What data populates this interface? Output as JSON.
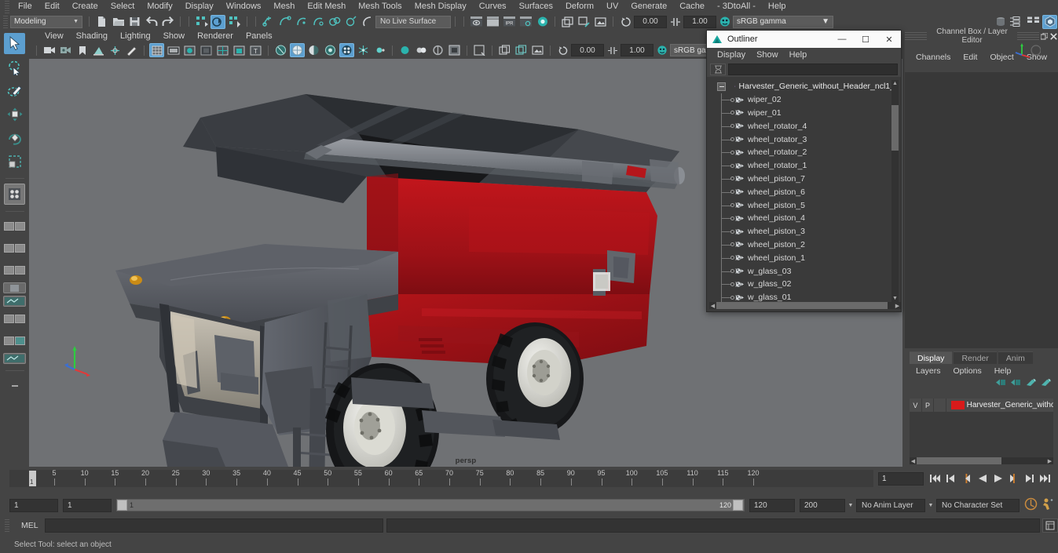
{
  "menubar": {
    "items": [
      "File",
      "Edit",
      "Create",
      "Select",
      "Modify",
      "Display",
      "Windows",
      "Mesh",
      "Edit Mesh",
      "Mesh Tools",
      "Mesh Display",
      "Curves",
      "Surfaces",
      "Deform",
      "UV",
      "Generate",
      "Cache",
      "- 3DtoAll -",
      "Help"
    ]
  },
  "statusline": {
    "menuset": "Modeling",
    "live_surface": "No Live Surface",
    "snap_value_a": "0.00",
    "snap_value_b": "1.00",
    "color_management": "sRGB gamma"
  },
  "viewport": {
    "menu": [
      "View",
      "Shading",
      "Lighting",
      "Show",
      "Renderer",
      "Panels"
    ],
    "camera_label": "persp",
    "background_color": "#6f7174",
    "body_color": "#a01218",
    "metal_color": "#5a5d64",
    "dark_color": "#3b3d42"
  },
  "outliner": {
    "title": "Outliner",
    "menu": [
      "Display",
      "Show",
      "Help"
    ],
    "search_value": "",
    "search_placeholder": "",
    "root": "Harvester_Generic_without_Header_ncl1_",
    "items": [
      "wiper_02",
      "wiper_01",
      "wheel_rotator_4",
      "wheel_rotator_3",
      "wheel_rotator_2",
      "wheel_rotator_1",
      "wheel_piston_7",
      "wheel_piston_6",
      "wheel_piston_5",
      "wheel_piston_4",
      "wheel_piston_3",
      "wheel_piston_2",
      "wheel_piston_1",
      "w_glass_03",
      "w_glass_02",
      "w_glass_01"
    ],
    "window_buttons": {
      "minimize": "—",
      "maximize": "☐",
      "close": "✕"
    }
  },
  "channelbox": {
    "title": "Channel Box / Layer Editor",
    "menu": [
      "Channels",
      "Edit",
      "Object",
      "Show"
    ]
  },
  "layereditor": {
    "tabs": [
      "Display",
      "Render",
      "Anim"
    ],
    "active_tab": "Display",
    "menu": [
      "Layers",
      "Options",
      "Help"
    ],
    "rows": [
      {
        "v": "V",
        "p": "P",
        "color": "#d81a1a",
        "name": "Harvester_Generic_witho"
      }
    ]
  },
  "timeline": {
    "ticks": [
      5,
      10,
      15,
      20,
      25,
      30,
      35,
      40,
      45,
      50,
      55,
      60,
      65,
      70,
      75,
      80,
      85,
      90,
      95,
      100,
      105,
      110,
      115,
      120
    ],
    "start": 1,
    "end": 120,
    "current_frame": "1",
    "playhead_frame": "1"
  },
  "rangeslider": {
    "anim_start": "1",
    "range_start": "1",
    "bar_left_label": "1",
    "bar_right_label": "120",
    "range_end": "120",
    "anim_end": "200",
    "anim_layer": "No Anim Layer",
    "character_set": "No Character Set"
  },
  "commandline": {
    "language": "MEL",
    "input_value": "",
    "output_value": ""
  },
  "helpline": {
    "text": "Select Tool: select an object"
  }
}
